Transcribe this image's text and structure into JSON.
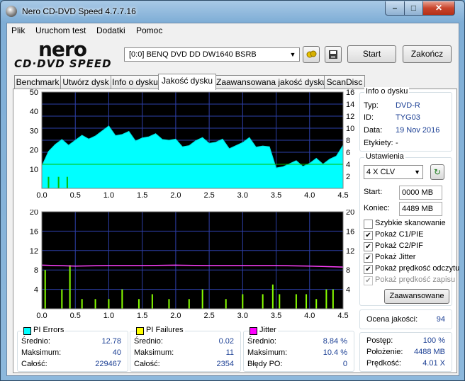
{
  "window": {
    "title": "Nero CD-DVD Speed 4.7.7.16",
    "min": "–",
    "max": "□",
    "close": "✕"
  },
  "menu": [
    "Plik",
    "Uruchom test",
    "Dodatki",
    "Pomoc"
  ],
  "logo": {
    "nero": "nero",
    "cdspeed": "CD·DVD SPEED"
  },
  "toolbar": {
    "drive": "[0:0]   BENQ DVD DD DW1640 BSRB",
    "start": "Start",
    "finish": "Zakończ",
    "refresh_icon": "eject-refresh-icon",
    "save_icon": "save-icon"
  },
  "tabs": [
    "Benchmark",
    "Utwórz dysk",
    "Info o dysku",
    "Jakość dysku",
    "Zaawansowana jakość dysku",
    "ScanDisc"
  ],
  "active_tab": 3,
  "disc_info": {
    "title": "Info o dysku",
    "rows": [
      {
        "label": "Typ:",
        "value": "DVD-R"
      },
      {
        "label": "ID:",
        "value": "TYG03"
      },
      {
        "label": "Data:",
        "value": "19 Nov 2016"
      },
      {
        "label": "Etykiety:",
        "value": "-"
      }
    ]
  },
  "settings": {
    "title": "Ustawienia",
    "speed": "4 X CLV",
    "start_label": "Start:",
    "start_value": "0000 MB",
    "end_label": "Koniec:",
    "end_value": "4489 MB",
    "checks": [
      {
        "label": "Szybkie skanowanie",
        "checked": false,
        "disabled": false
      },
      {
        "label": "Pokaż C1/PIE",
        "checked": true,
        "disabled": false
      },
      {
        "label": "Pokaż C2/PIF",
        "checked": true,
        "disabled": false
      },
      {
        "label": "Pokaż Jitter",
        "checked": true,
        "disabled": false
      },
      {
        "label": "Pokaż prędkość odczytu",
        "checked": true,
        "disabled": false
      },
      {
        "label": "Pokaż prędkość zapisu",
        "checked": true,
        "disabled": true
      }
    ],
    "advanced": "Zaawansowane"
  },
  "quality": {
    "label": "Ocena jakości:",
    "value": "94"
  },
  "progress": {
    "rows": [
      {
        "label": "Postęp:",
        "value": "100 %"
      },
      {
        "label": "Położenie:",
        "value": "4488 MB"
      },
      {
        "label": "Prędkość:",
        "value": "4.01 X"
      }
    ]
  },
  "stats": {
    "pi_errors": {
      "title": "PI Errors",
      "color": "#00ffff",
      "rows": [
        {
          "label": "Średnio:",
          "value": "12.78"
        },
        {
          "label": "Maksimum:",
          "value": "40"
        },
        {
          "label": "Całość:",
          "value": "229467"
        }
      ]
    },
    "pi_failures": {
      "title": "PI Failures",
      "color": "#ffff00",
      "rows": [
        {
          "label": "Średnio:",
          "value": "0.02"
        },
        {
          "label": "Maksimum:",
          "value": "11"
        },
        {
          "label": "Całość:",
          "value": "2354"
        }
      ]
    },
    "jitter": {
      "title": "Jitter",
      "color": "#ff00ff",
      "rows": [
        {
          "label": "Średnio:",
          "value": "8.84 %"
        },
        {
          "label": "Maksimum:",
          "value": "10.4 %"
        },
        {
          "label": "Błędy PO:",
          "value": "0"
        }
      ]
    }
  },
  "chart_data": [
    {
      "type": "area",
      "name": "PI Errors / read speed",
      "x_ticks": [
        "0.0",
        "0.5",
        "1.0",
        "1.5",
        "2.0",
        "2.5",
        "3.0",
        "3.5",
        "4.0",
        "4.5"
      ],
      "y_left_ticks": [
        "10",
        "20",
        "30",
        "40",
        "50"
      ],
      "y_right_ticks": [
        "2",
        "4",
        "6",
        "8",
        "10",
        "12",
        "14",
        "16"
      ],
      "xlim": [
        0,
        4.5
      ],
      "ylim_left": [
        0,
        50
      ],
      "ylim_right": [
        0,
        16
      ],
      "pi_errors": {
        "x": [
          0,
          0.1,
          0.2,
          0.3,
          0.4,
          0.5,
          0.6,
          0.7,
          0.8,
          0.9,
          1.0,
          1.1,
          1.2,
          1.3,
          1.4,
          1.5,
          1.6,
          1.7,
          1.8,
          1.9,
          2.0,
          2.1,
          2.2,
          2.3,
          2.4,
          2.5,
          2.6,
          2.7,
          2.8,
          2.9,
          3.0,
          3.1,
          3.2,
          3.3,
          3.4,
          3.5,
          3.6,
          3.7,
          3.8,
          3.9,
          4.0,
          4.1,
          4.2,
          4.3,
          4.4,
          4.5
        ],
        "values": [
          14,
          20,
          22,
          23,
          24,
          25,
          26,
          28,
          28,
          29,
          30,
          29,
          28,
          28,
          27,
          27,
          26,
          26,
          27,
          25,
          24,
          24,
          23,
          24,
          24,
          25,
          24,
          24,
          23,
          23,
          23,
          24,
          23,
          22,
          20,
          13,
          12,
          12,
          12,
          13,
          13,
          14,
          15,
          16,
          16,
          20
        ]
      },
      "read_speed": {
        "x": [
          0,
          4.5
        ],
        "values": [
          4.0,
          4.0
        ]
      },
      "pi_failure_dips": [
        0.1,
        0.25,
        0.38
      ]
    },
    {
      "type": "line",
      "name": "PI Failures / jitter",
      "x_ticks": [
        "0.0",
        "0.5",
        "1.0",
        "1.5",
        "2.0",
        "2.5",
        "3.0",
        "3.5",
        "4.0",
        "4.5"
      ],
      "y_left_ticks": [
        "4",
        "8",
        "12",
        "16",
        "20"
      ],
      "y_right_ticks": [
        "4",
        "8",
        "12",
        "16",
        "20"
      ],
      "xlim": [
        0,
        4.5
      ],
      "ylim_left": [
        0,
        20
      ],
      "ylim_right": [
        0,
        20
      ],
      "jitter": {
        "x": [
          0,
          0.5,
          1.0,
          1.5,
          2.0,
          2.5,
          3.0,
          3.5,
          4.0,
          4.5
        ],
        "values": [
          9.0,
          8.8,
          8.9,
          8.9,
          9.0,
          8.9,
          8.9,
          8.9,
          8.8,
          8.6
        ]
      },
      "pi_failures": {
        "x": [
          0.05,
          0.3,
          0.42,
          0.6,
          0.8,
          1.0,
          1.2,
          1.45,
          1.65,
          1.9,
          2.2,
          2.4,
          2.75,
          3.0,
          3.3,
          3.45,
          3.55,
          3.8,
          3.95,
          4.1,
          4.25,
          4.35
        ],
        "values": [
          8,
          4,
          9,
          2,
          2,
          2,
          4,
          2,
          3,
          2,
          2,
          4,
          2,
          3,
          3,
          5,
          3,
          3,
          3,
          2,
          4,
          4
        ]
      }
    }
  ]
}
